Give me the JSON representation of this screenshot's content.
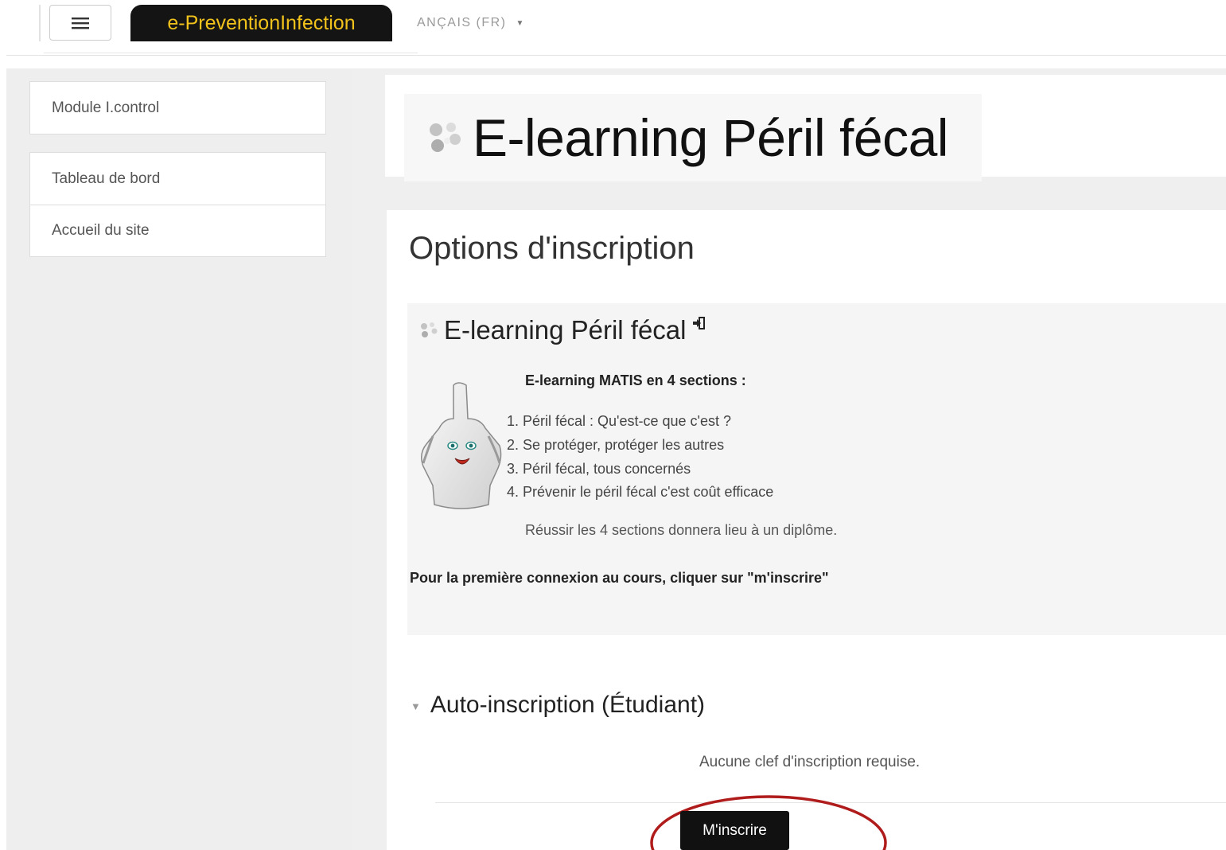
{
  "header": {
    "menu_icon": "hamburger-icon",
    "brand": "e-PreventionInfection",
    "language": "ANÇAIS (FR)",
    "language_icon": "caret-down-icon",
    "colors": {
      "brand_bg": "#141414",
      "brand_text": "#f1c21b"
    }
  },
  "sidebar": {
    "blocks": [
      {
        "items": [
          {
            "label": "Module I.control"
          }
        ]
      },
      {
        "items": [
          {
            "label": "Tableau de bord"
          },
          {
            "label": "Accueil du site"
          }
        ]
      }
    ]
  },
  "page": {
    "title": "E-learning Péril fécal",
    "title_icon": "course-cube-icon",
    "section_title": "Options d'inscription"
  },
  "course": {
    "name": "E-learning Péril fécal",
    "icons": {
      "course": "course-cube-icon",
      "enter": "enter-icon",
      "illustration": "apron-mascot-icon"
    },
    "summary_heading": "E-learning MATIS en 4 sections :",
    "sections": [
      "1. Péril fécal : Qu'est-ce que c'est ?",
      "2. Se protéger, protéger les autres",
      "3. Péril fécal, tous concernés",
      "4. Prévenir le péril fécal c'est coût efficace"
    ],
    "note": "Réussir les 4 sections donnera lieu à un diplôme.",
    "first_login": "Pour la première connexion au cours, cliquer sur \"m'inscrire\""
  },
  "enrolment": {
    "heading": "Auto-inscription (Étudiant)",
    "toggle_icon": "triangle-down-icon",
    "no_key": "Aucune clef d'inscription requise.",
    "button": "M'inscrire",
    "highlight_color": "#b01c1c"
  }
}
